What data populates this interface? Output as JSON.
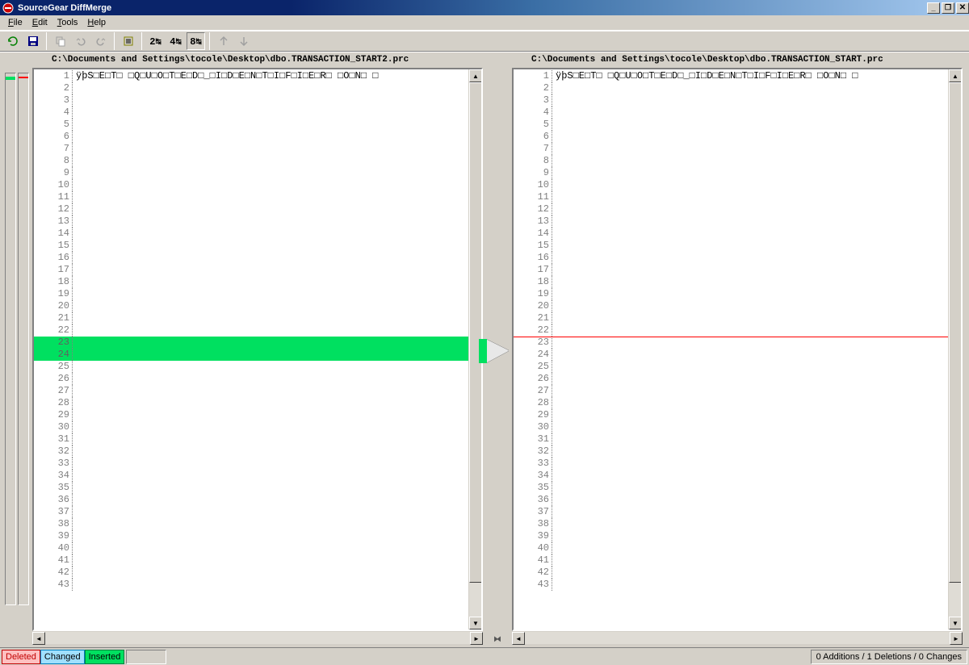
{
  "window": {
    "title": "SourceGear DiffMerge"
  },
  "menu": {
    "file": "File",
    "edit": "Edit",
    "tools": "Tools",
    "help": "Help"
  },
  "toolbar": {
    "btn_2way": "2↹",
    "btn_4way": "4↹",
    "btn_8way": "8↹"
  },
  "left": {
    "path": "C:\\Documents and Settings\\tocole\\Desktop\\dbo.TRANSACTION_START2.prc",
    "line1": "ÿþS□E□T□ □Q□U□O□T□E□D□_□I□D□E□N□T□I□F□I□E□R□ □O□N□ □"
  },
  "right": {
    "path": "C:\\Documents and Settings\\tocole\\Desktop\\dbo.TRANSACTION_START.prc",
    "line1": "ÿþS□E□T□ □Q□U□O□T□E□D□_□I□D□E□N□T□I□F□I□E□R□ □O□N□ □"
  },
  "lines": {
    "count": 43,
    "insert_start": 23,
    "insert_end": 24,
    "delete_at": 23
  },
  "legend": {
    "deleted": "Deleted",
    "changed": "Changed",
    "inserted": "Inserted"
  },
  "status": {
    "summary": "0 Additions / 1 Deletions / 0 Changes"
  },
  "colors": {
    "insert": "#00e060",
    "delete": "#ff0000",
    "titlebar_dark": "#0a246a",
    "titlebar_light": "#a6caf0",
    "chrome": "#d4d0c8"
  }
}
